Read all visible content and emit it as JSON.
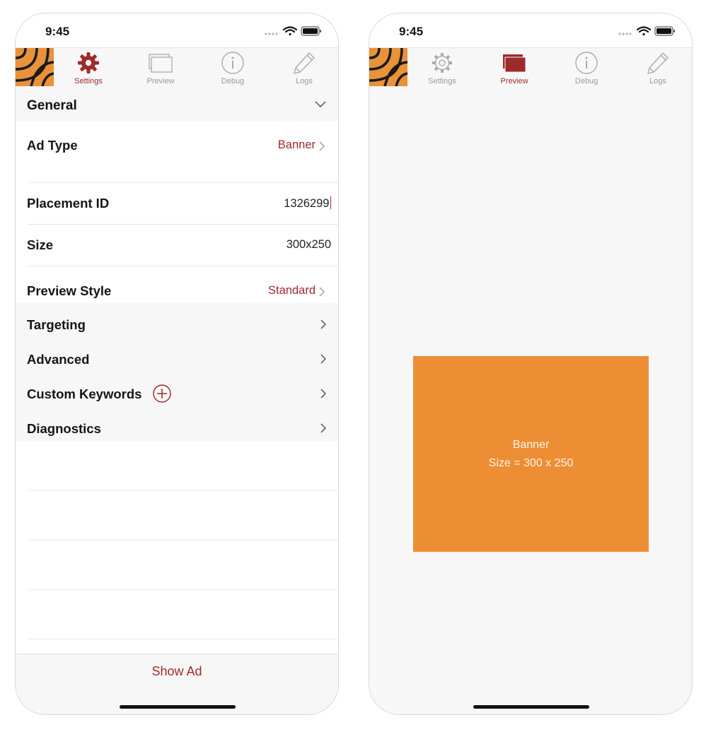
{
  "colors": {
    "accent": "#9e2a2b",
    "banner": "#ee8e34",
    "logo": "#e8923a"
  },
  "left": {
    "status_time": "9:45",
    "tabs": [
      {
        "label": "Settings",
        "icon": "gear-icon",
        "active": true
      },
      {
        "label": "Preview",
        "icon": "preview-window-icon",
        "active": false
      },
      {
        "label": "Debug",
        "icon": "info-circle-icon",
        "active": false
      },
      {
        "label": "Logs",
        "icon": "pencil-icon",
        "active": false
      }
    ],
    "section_header": "General",
    "rows": [
      {
        "label": "Ad Type",
        "value": "Banner"
      },
      {
        "label": "Placement ID",
        "value": "1326299"
      },
      {
        "label": "Size",
        "value": "300x250"
      },
      {
        "label": "Preview Style",
        "value": "Standard"
      }
    ],
    "menu_rows": [
      {
        "label": "Targeting"
      },
      {
        "label": "Advanced"
      },
      {
        "label": "Custom Keywords"
      },
      {
        "label": "Diagnostics"
      }
    ],
    "show_ad": "Show Ad"
  },
  "right": {
    "status_time": "9:45",
    "tabs": [
      {
        "label": "Settings",
        "icon": "gear-icon",
        "active": false
      },
      {
        "label": "Preview",
        "icon": "preview-window-icon",
        "active": true
      },
      {
        "label": "Debug",
        "icon": "info-circle-icon",
        "active": false
      },
      {
        "label": "Logs",
        "icon": "pencil-icon",
        "active": false
      }
    ],
    "banner": {
      "title": "Banner",
      "size_text": "Size = 300 x 250"
    }
  }
}
